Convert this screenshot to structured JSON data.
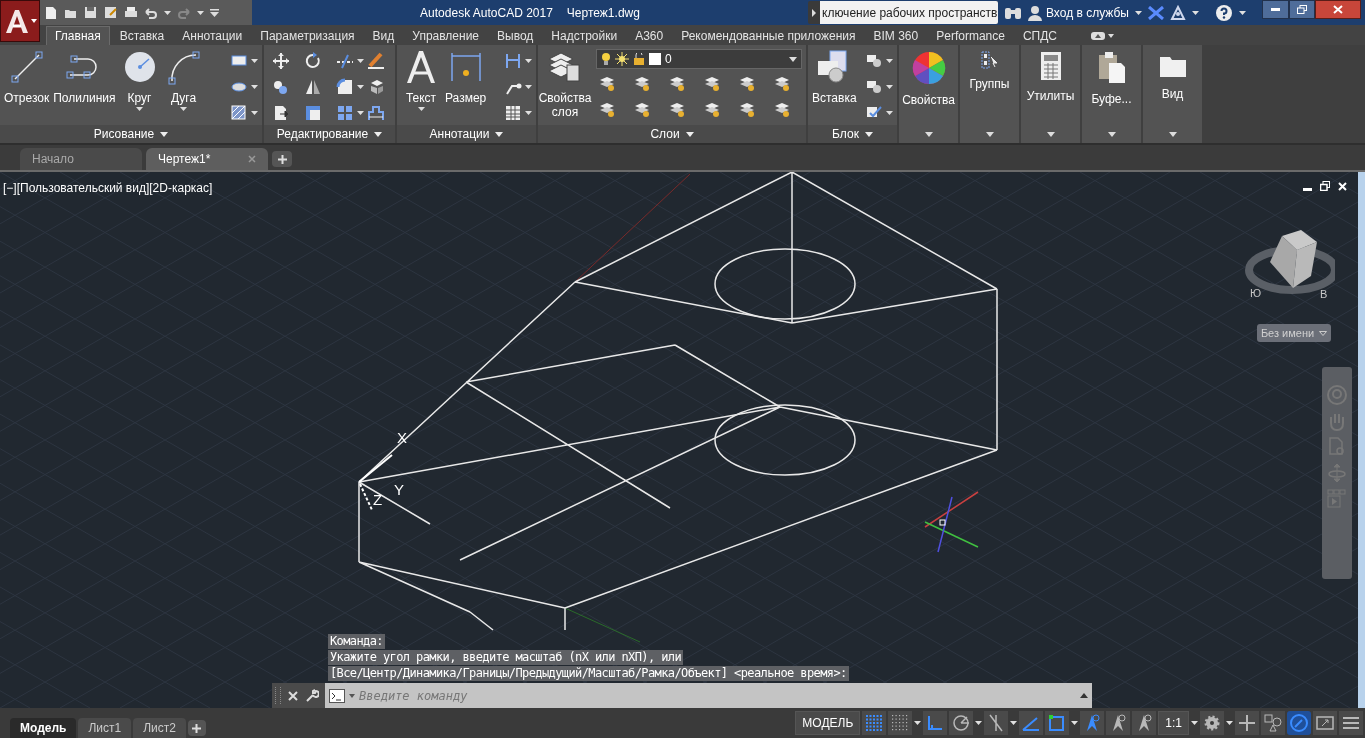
{
  "title_bar": {
    "title": "Autodesk AutoCAD 2017",
    "file": "Чертеж1.dwg",
    "search": "ключение рабочих пространств",
    "sign_in": "Вход в службы"
  },
  "ribbon_tabs": [
    {
      "label": "Главная",
      "selected": true
    },
    {
      "label": "Вставка",
      "selected": false
    },
    {
      "label": "Аннотации",
      "selected": false
    },
    {
      "label": "Параметризация",
      "selected": false
    },
    {
      "label": "Вид",
      "selected": false
    },
    {
      "label": "Управление",
      "selected": false
    },
    {
      "label": "Вывод",
      "selected": false
    },
    {
      "label": "Надстройки",
      "selected": false
    },
    {
      "label": "A360",
      "selected": false
    },
    {
      "label": "Рекомендованные приложения",
      "selected": false
    },
    {
      "label": "BIM 360",
      "selected": false
    },
    {
      "label": "Performance",
      "selected": false
    },
    {
      "label": "СПДС",
      "selected": false
    }
  ],
  "ribbon_panels": [
    {
      "kind": "expanded",
      "title": "Рисование",
      "large": [
        {
          "label": "Отрезок",
          "kind": "line",
          "menu": false
        },
        {
          "label": "Полилиния",
          "kind": "polyline",
          "menu": false
        },
        {
          "label": "Круг",
          "kind": "circle",
          "menu": true
        },
        {
          "label": "Дуга",
          "kind": "arc",
          "menu": true
        }
      ]
    },
    {
      "kind": "expanded",
      "title": "Редактирование"
    },
    {
      "kind": "expanded",
      "title": "Аннотации",
      "large": [
        {
          "label": "Текст",
          "kind": "text",
          "menu": true
        },
        {
          "label": "Размер",
          "kind": "dimension",
          "menu": false
        }
      ]
    },
    {
      "kind": "layers",
      "title": "Слои",
      "large": [
        {
          "label": "Свойства слоя",
          "kind": "layers",
          "menu": false
        }
      ],
      "layer": "0"
    },
    {
      "kind": "expanded",
      "title": "Блок",
      "large": [
        {
          "label": "Вставка",
          "kind": "insert",
          "menu": false
        }
      ]
    },
    {
      "kind": "collapsed",
      "label": "Свойства"
    },
    {
      "kind": "collapsed",
      "label": "Группы"
    },
    {
      "kind": "collapsed",
      "label": "Утилиты"
    },
    {
      "kind": "collapsed",
      "label": "Буфе..."
    },
    {
      "kind": "collapsed",
      "label": "Вид"
    }
  ],
  "file_tabs": [
    {
      "label": "Начало",
      "selected": false
    },
    {
      "label": "Чертеж1*",
      "selected": true
    }
  ],
  "viewport": {
    "label": "[−][Пользовательский вид][2D-каркас]",
    "compass": [
      "Ю",
      "В"
    ],
    "named_view": "Без имени",
    "axes": [
      "X",
      "Y",
      "Z"
    ]
  },
  "command_history": [
    "Команда:",
    "Укажите угол рамки, введите масштаб (nX или nXП), или",
    "[Все/Центр/Динамика/Границы/Предыдущий/Масштаб/Рамка/Объект] <реальное время>:"
  ],
  "command_line": {
    "placeholder": "Введите команду"
  },
  "layout_tabs": [
    {
      "label": "Модель",
      "selected": true
    },
    {
      "label": "Лист1",
      "selected": false
    },
    {
      "label": "Лист2",
      "selected": false
    }
  ],
  "status_bar": [
    {
      "kind": "text",
      "label": "МОДЕЛЬ"
    },
    {
      "kind": "grid",
      "on": true
    },
    {
      "kind": "snap",
      "on": false
    },
    {
      "kind": "drop"
    },
    {
      "kind": "ortho",
      "on": true
    },
    {
      "kind": "polar",
      "on": false
    },
    {
      "kind": "drop"
    },
    {
      "kind": "iso",
      "on": false
    },
    {
      "kind": "drop"
    },
    {
      "kind": "ducs",
      "on": true
    },
    {
      "kind": "dyn",
      "on": true
    },
    {
      "kind": "drop"
    },
    {
      "kind": "annot",
      "on": true
    },
    {
      "kind": "annot",
      "on": false
    },
    {
      "kind": "annot",
      "on": false
    },
    {
      "kind": "text",
      "label": "1:1"
    },
    {
      "kind": "drop"
    },
    {
      "kind": "gear",
      "on": false
    },
    {
      "kind": "drop"
    },
    {
      "kind": "plus",
      "on": false
    },
    {
      "kind": "shapes",
      "on": false
    },
    {
      "kind": "accel",
      "on": true
    },
    {
      "kind": "full",
      "on": false
    },
    {
      "kind": "menu",
      "on": false
    }
  ]
}
